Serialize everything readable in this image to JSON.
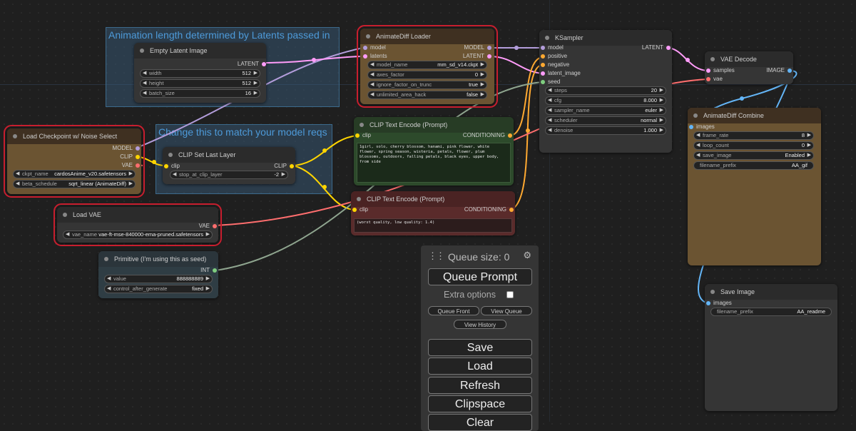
{
  "groups": {
    "latents": "Animation length determined by Latents passed in",
    "model_reqs": "Change this to match your model reqs"
  },
  "nodes": {
    "empty_latent": {
      "title": "Empty Latent Image",
      "output": "LATENT",
      "width_label": "width",
      "width_value": "512",
      "height_label": "height",
      "height_value": "512",
      "batch_label": "batch_size",
      "batch_value": "16"
    },
    "animatediff_loader": {
      "title": "AnimateDiff Loader",
      "in_model": "model",
      "in_latents": "latents",
      "out_model": "MODEL",
      "out_latent": "LATENT",
      "w1_label": "model_name",
      "w1_value": "mm_sd_v14.ckpt",
      "w2_label": "axes_factor",
      "w2_value": "0",
      "w3_label": "ignore_factor_on_trunc",
      "w3_value": "true",
      "w4_label": "unlimited_area_hack",
      "w4_value": "false"
    },
    "ksampler": {
      "title": "KSampler",
      "in_model": "model",
      "in_positive": "positive",
      "in_negative": "negative",
      "in_latent": "latent_image",
      "in_seed": "seed",
      "out_latent": "LATENT",
      "steps_label": "steps",
      "steps_value": "20",
      "cfg_label": "cfg",
      "cfg_value": "8.000",
      "sampler_label": "sampler_name",
      "sampler_value": "euler",
      "scheduler_label": "scheduler",
      "scheduler_value": "normal",
      "denoise_label": "denoise",
      "denoise_value": "1.000"
    },
    "vae_decode": {
      "title": "VAE Decode",
      "in_samples": "samples",
      "in_vae": "vae",
      "out_image": "IMAGE"
    },
    "load_checkpoint": {
      "title": "Load Checkpoint w/ Noise Select",
      "out_model": "MODEL",
      "out_clip": "CLIP",
      "out_vae": "VAE",
      "ckpt_label": "ckpt_name",
      "ckpt_value": "cardosAnime_v20.safetensors",
      "beta_label": "beta_schedule",
      "beta_value": "sqrt_linear (AnimateDiff)"
    },
    "clip_set_last": {
      "title": "CLIP Set Last Layer",
      "in_clip": "clip",
      "out_clip": "CLIP",
      "stop_label": "stop_at_clip_layer",
      "stop_value": "-2"
    },
    "clip_pos": {
      "title": "CLIP Text Encode (Prompt)",
      "in_clip": "clip",
      "out_cond": "CONDITIONING",
      "text": "1girl, solo, cherry blossom, hanami, pink flower, white flower, spring season, wisteria, petals, flower, plum blossoms, outdoors, falling petals, black eyes, upper body, from side"
    },
    "clip_neg": {
      "title": "CLIP Text Encode (Prompt)",
      "in_clip": "clip",
      "out_cond": "CONDITIONING",
      "text": "(worst quality, low quality: 1.4)"
    },
    "load_vae": {
      "title": "Load VAE",
      "out_vae": "VAE",
      "vae_label": "vae_name",
      "vae_value": "vae-ft-mse-840000-ema-pruned.safetensors"
    },
    "primitive": {
      "title": "Primitive (I'm using this as seed)",
      "out_int": "INT",
      "value_label": "value",
      "value_value": "888888889",
      "control_label": "control_after_generate",
      "control_value": "fixed"
    },
    "animatediff_combine": {
      "title": "AnimateDiff Combine",
      "in_images": "images",
      "fr_label": "frame_rate",
      "fr_value": "8",
      "loop_label": "loop_count",
      "loop_value": "0",
      "save_label": "save_image",
      "save_value": "Enabled",
      "prefix_label": "filename_prefix",
      "prefix_value": "AA_gif"
    },
    "save_image": {
      "title": "Save Image",
      "in_images": "images",
      "prefix_label": "filename_prefix",
      "prefix_value": "AA_readme"
    }
  },
  "menu": {
    "queue_size": "Queue size: 0",
    "queue_prompt": "Queue Prompt",
    "extra_options": "Extra options",
    "queue_front": "Queue Front",
    "view_queue": "View Queue",
    "view_history": "View History",
    "save": "Save",
    "load": "Load",
    "refresh": "Refresh",
    "clipspace": "Clipspace",
    "clear": "Clear"
  },
  "colors": {
    "model_wire": "#b39ddb",
    "latent_wire": "#ff9cf9",
    "clip_wire": "#ffd500",
    "conditioning_wire": "#ffa931",
    "vae_wire": "#ff6e6e",
    "image_wire": "#64b5f6",
    "int_wire": "#7fce7f",
    "selected_outline": "#c81e2e"
  }
}
